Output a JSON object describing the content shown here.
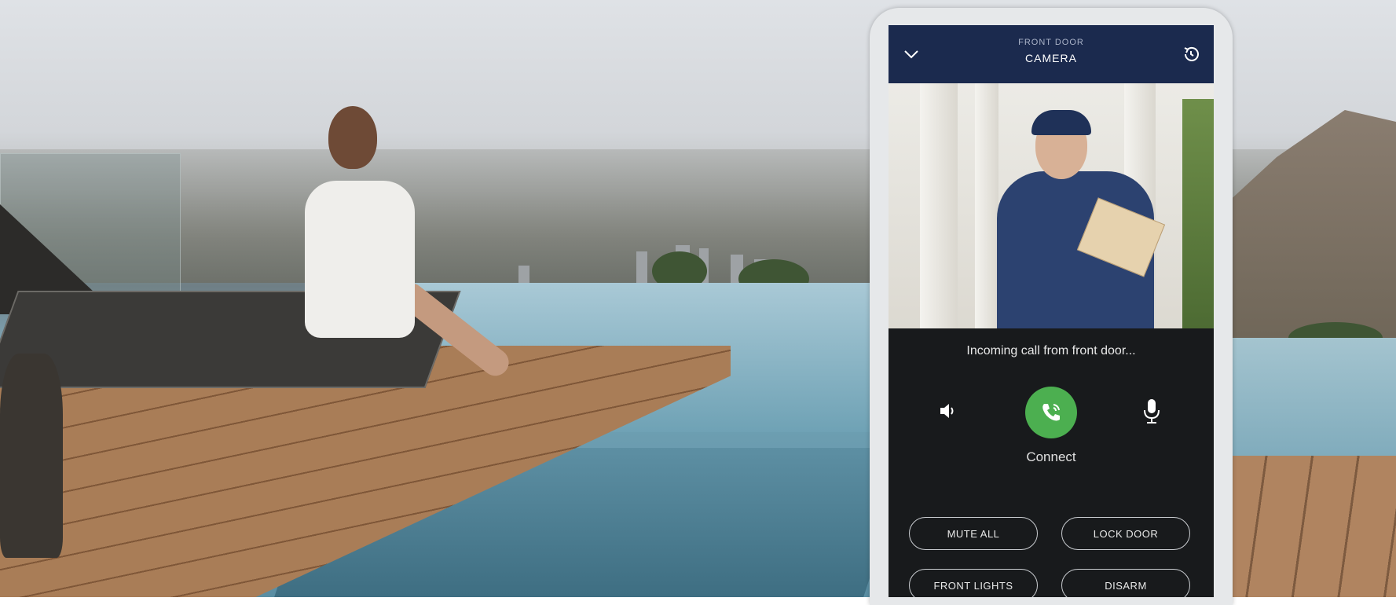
{
  "camera_header": {
    "subtitle": "FRONT DOOR",
    "title": "CAMERA"
  },
  "call_panel": {
    "status_text": "Incoming call from front door...",
    "connect_label": "Connect"
  },
  "actions": [
    {
      "label": "MUTE ALL"
    },
    {
      "label": "LOCK DOOR"
    },
    {
      "label": "FRONT LIGHTS"
    },
    {
      "label": "DISARM"
    }
  ],
  "icons": {
    "back": "chevron-down-icon",
    "history": "history-icon",
    "speaker": "speaker-icon",
    "connect": "phone-call-icon",
    "mic": "microphone-icon"
  },
  "colors": {
    "header": "#1b2a4e",
    "connect": "#4caf50"
  }
}
